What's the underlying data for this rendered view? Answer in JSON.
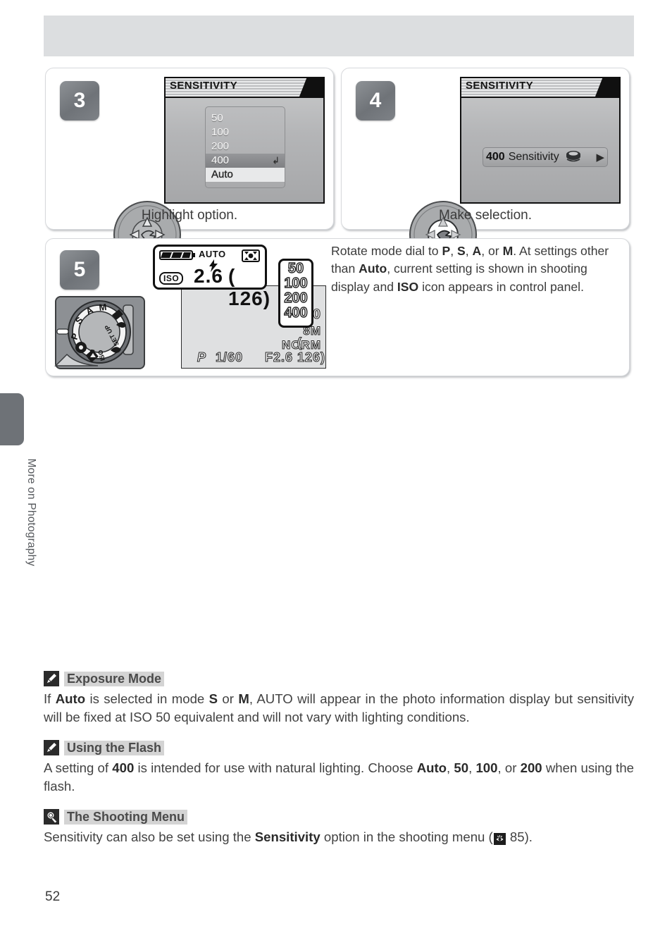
{
  "page": {
    "number": "52",
    "side_tab_label": "More on Photography"
  },
  "steps": [
    {
      "badge": "3",
      "caption": "Highlight option.",
      "screen": {
        "title": "SENSITIVITY",
        "menu_items": [
          {
            "label": "50",
            "state": "normal"
          },
          {
            "label": "100",
            "state": "normal"
          },
          {
            "label": "200",
            "state": "normal"
          },
          {
            "label": "400",
            "state": "highlight"
          },
          {
            "label": "Auto",
            "state": "selected"
          }
        ],
        "enter_glyph": "↲"
      }
    },
    {
      "badge": "4",
      "caption": "Make selection.",
      "screen": {
        "title": "SENSITIVITY",
        "bar_value": "400",
        "bar_label": "Sensitivity",
        "bar_arrow": "▶"
      }
    },
    {
      "badge": "5",
      "text_parts": [
        {
          "t": "Rotate mode dial to ",
          "b": false
        },
        {
          "t": "P",
          "b": true
        },
        {
          "t": ", ",
          "b": false
        },
        {
          "t": "S",
          "b": true
        },
        {
          "t": ", ",
          "b": false
        },
        {
          "t": "A",
          "b": true
        },
        {
          "t": ", or ",
          "b": false
        },
        {
          "t": "M",
          "b": true
        },
        {
          "t": ".  At settings other than ",
          "b": false
        },
        {
          "t": "Auto",
          "b": true
        },
        {
          "t": ", current setting is shown in shooting display and ",
          "b": false
        },
        {
          "t": "ISO",
          "b": true
        },
        {
          "t": " icon appears in control panel.",
          "b": false
        }
      ]
    }
  ],
  "mode_dial": {
    "labels": [
      "P",
      "S",
      "A",
      "M",
      "SET UP",
      "WB",
      "ISO"
    ]
  },
  "control_panel": {
    "auto_label": "AUTO",
    "iso_label": "ISO",
    "aperture": "2.6",
    "frames": "( 126)",
    "flash_glyph": "⚡"
  },
  "shooting_display": {
    "iso_callout": [
      "50",
      "100",
      "200",
      "400"
    ],
    "current_iso": "400",
    "image_size": "8M",
    "image_quality": "NORM",
    "mode": "P",
    "shutter": "1/60",
    "aperture": "F2.6",
    "frames": "( 126)"
  },
  "notes": [
    {
      "icon": "pencil-icon",
      "title": "Exposure Mode",
      "body_parts": [
        {
          "t": "If ",
          "b": false
        },
        {
          "t": "Auto",
          "b": true
        },
        {
          "t": " is selected in mode ",
          "b": false
        },
        {
          "t": "S",
          "b": true
        },
        {
          "t": " or ",
          "b": false
        },
        {
          "t": "M",
          "b": true
        },
        {
          "t": ", AUTO will appear in the photo information display but sensitivity will be fixed at ISO 50 equivalent and will not vary with lighting conditions.",
          "b": false
        }
      ]
    },
    {
      "icon": "pencil-icon",
      "title": "Using the Flash",
      "body_parts": [
        {
          "t": "A setting of ",
          "b": false
        },
        {
          "t": "400",
          "b": true
        },
        {
          "t": " is intended for use with natural lighting.  Choose ",
          "b": false
        },
        {
          "t": "Auto",
          "b": true
        },
        {
          "t": ", ",
          "b": false
        },
        {
          "t": "50",
          "b": true
        },
        {
          "t": ", ",
          "b": false
        },
        {
          "t": "100",
          "b": true
        },
        {
          "t": ", or ",
          "b": false
        },
        {
          "t": "200",
          "b": true
        },
        {
          "t": " when using the flash.",
          "b": false
        }
      ]
    },
    {
      "icon": "magnifier-icon",
      "title": "The Shooting Menu",
      "body_parts": [
        {
          "t": "Sensitivity can also be set using the ",
          "b": false
        },
        {
          "t": "Sensitivity",
          "b": true
        },
        {
          "t": " option in the shooting menu (",
          "b": false
        },
        {
          "t": "__EYE_ICON__",
          "b": false
        },
        {
          "t": " 85).",
          "b": false
        }
      ]
    }
  ],
  "colors": {
    "header_bar": "#dcdee0",
    "side_tab": "#6e7277",
    "badge": "#7f8387",
    "note_highlight": "#d4d4d4"
  }
}
